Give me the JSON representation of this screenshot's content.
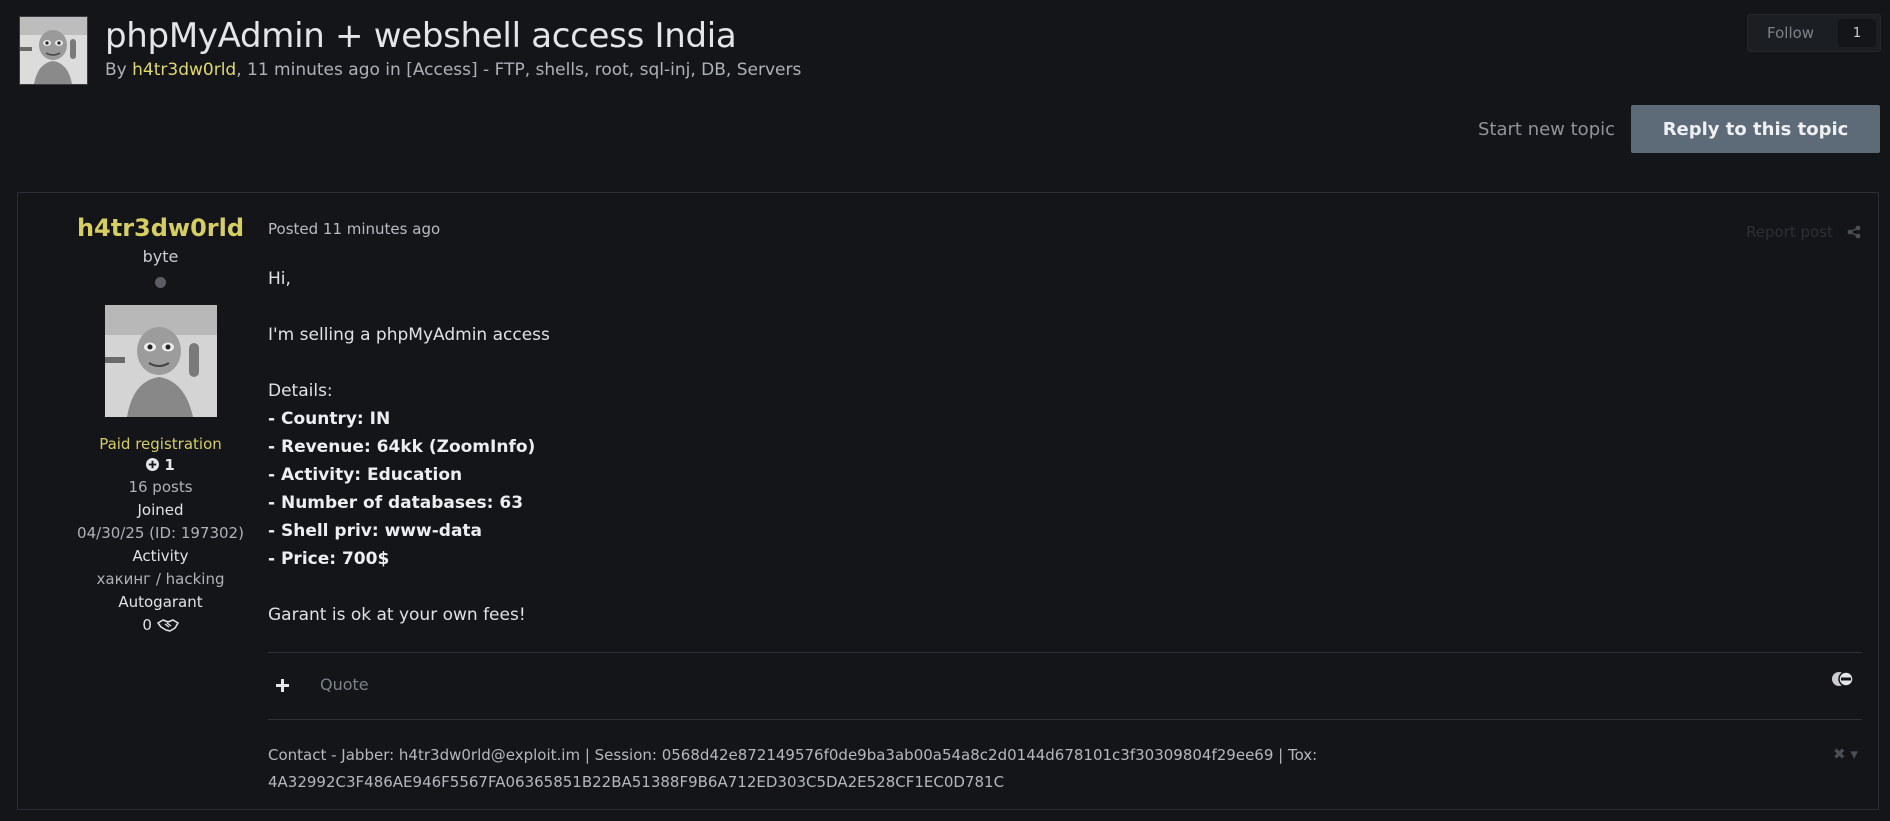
{
  "topic": {
    "title": "phpMyAdmin + webshell access India",
    "by_prefix": "By ",
    "author": "h4tr3dw0rld",
    "meta_suffix": ", 11 minutes ago in [Access] - FTP, shells, root, sql-inj, DB, Servers"
  },
  "follow": {
    "label": "Follow",
    "count": "1"
  },
  "actions": {
    "start_new_topic": "Start new topic",
    "reply": "Reply to this topic"
  },
  "post": {
    "author": {
      "name": "h4tr3dw0rld",
      "rank": "byte",
      "group": "Paid registration",
      "reputation": "1",
      "posts": "16 posts",
      "joined_label": "Joined",
      "joined_value": "04/30/25 (ID: 197302)",
      "activity_label": "Activity",
      "activity_value": "хакинг / hacking",
      "autogarant_label": "Autogarant",
      "autogarant_value": "0"
    },
    "posted_prefix": "Posted ",
    "posted_time": "11 minutes ago",
    "report": "Report post",
    "body": {
      "greeting": "Hi,",
      "intro": "I'm selling a phpMyAdmin access",
      "details_label": "Details:",
      "details": [
        "- Country: IN",
        "- Revenue: 64kk (ZoomInfo)",
        "- Activity: Education",
        "- Number of databases: 63",
        "- Shell priv: www-data",
        "- Price: 700$"
      ],
      "closing": "Garant is ok at your own fees!"
    },
    "quote": "Quote",
    "signature_line1": "Contact - Jabber: h4tr3dw0rld@exploit.im | Session: 0568d42e872149576f0de9ba3ab00a54a8c2d0144d678101c3f30309804f29ee69 | Tox:",
    "signature_line2": "4A32992C3F486AE946F5567FA06365851B22BA51388F9B6A712ED303C5DA2E528CF1EC0D781C"
  },
  "colors": {
    "background": "#131519",
    "author_accent": "#d6cd63",
    "reply_button": "#5d6b79"
  },
  "icons": [
    "share-icon",
    "plus-icon",
    "handshake-icon",
    "reaction-icon",
    "close-icon",
    "chevron-down-icon"
  ]
}
